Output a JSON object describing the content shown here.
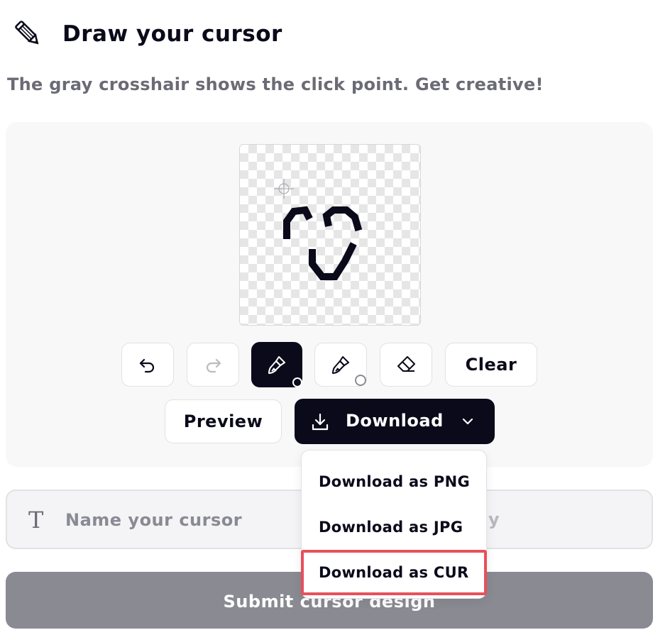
{
  "header": {
    "title": "Draw your cursor",
    "icon": "pencil-icon"
  },
  "subtitle": "The gray crosshair shows the click point. Get creative!",
  "toolbar": {
    "undo_icon": "undo-icon",
    "redo_icon": "redo-icon",
    "brush_icon": "brush-icon",
    "brush_large_icon": "brush-icon",
    "eraser_icon": "eraser-icon",
    "clear_label": "Clear",
    "preview_label": "Preview",
    "download_label": "Download",
    "download_icon": "download-icon",
    "chevron_icon": "chevron-down-icon"
  },
  "download_menu": {
    "items": [
      "Download as PNG",
      "Download as JPG",
      "Download as CUR"
    ],
    "highlighted": "Download as CUR"
  },
  "name_field": {
    "icon": "text-icon",
    "placeholder": "Name your cursor",
    "partial_hint": "y"
  },
  "submit": {
    "label": "Submit cursor design"
  },
  "colors": {
    "dark": "#0a0a1a",
    "panel": "#f8f8f9",
    "muted": "#6b6b76",
    "submit_bg": "#8a8a92",
    "highlight": "#e8505b"
  }
}
